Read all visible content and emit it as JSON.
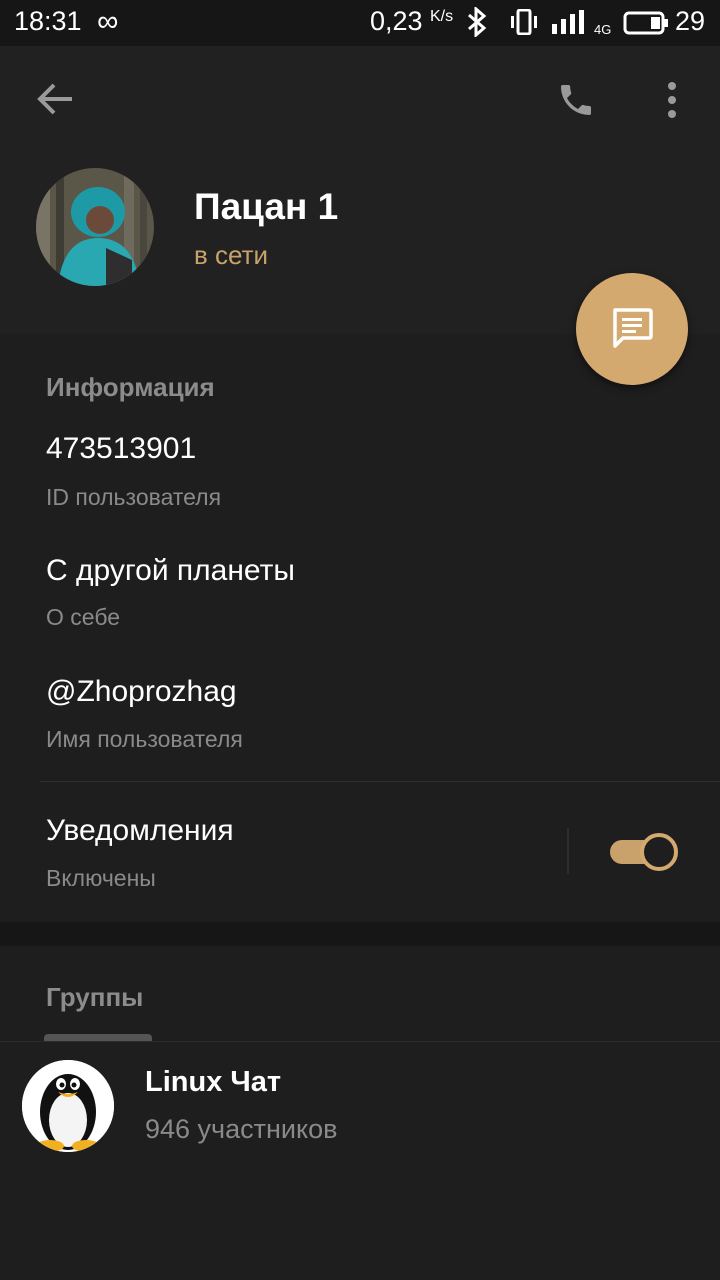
{
  "status_bar": {
    "time": "18:31",
    "infinity": "∞",
    "speed": "0,23",
    "speed_unit": "K/s",
    "network": "4G",
    "battery": "29"
  },
  "header": {
    "contact_name": "Пацан 1",
    "online_status": "в сети"
  },
  "info": {
    "section_title": "Информация",
    "fields": [
      {
        "value": "473513901",
        "label": "ID пользователя"
      },
      {
        "value": "С другой планеты",
        "label": "О себе"
      },
      {
        "value": "@Zhoprozhag",
        "label": "Имя пользователя"
      }
    ],
    "notifications": {
      "title": "Уведомления",
      "state": "Включены",
      "enabled": true
    }
  },
  "groups": {
    "section_title": "Группы",
    "items": [
      {
        "name": "Linux Чат",
        "members": "946 участников"
      }
    ]
  },
  "colors": {
    "accent": "#d4a96f",
    "status_text": "#c9a26b",
    "header_bg": "#212121",
    "body_bg": "#1e1e1e"
  },
  "icons": {
    "back": "arrow-left-icon",
    "call": "phone-icon",
    "more": "more-vertical-icon",
    "fab": "message-icon"
  }
}
